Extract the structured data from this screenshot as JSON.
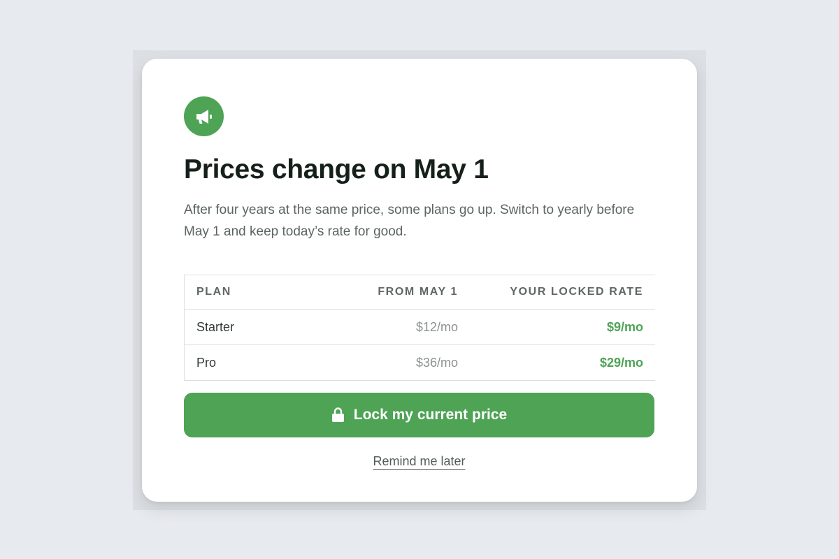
{
  "dialog": {
    "icon": "megaphone-icon",
    "title": "Prices change on May 1",
    "description": "After four years at the same price, some plans go up. Switch to yearly before May 1 and keep today’s rate for good."
  },
  "table": {
    "headers": [
      "PLAN",
      "FROM MAY 1",
      "YOUR LOCKED RATE"
    ],
    "rows": [
      [
        "Starter",
        "$12/mo",
        "$9/mo"
      ],
      [
        "Pro",
        "$36/mo",
        "$29/mo"
      ]
    ]
  },
  "actions": {
    "primary_icon": "lock-icon",
    "primary_label": "Lock my current price",
    "secondary_label": "Remind me later"
  },
  "colors": {
    "accent": "#4ea355",
    "background": "#e7eaee",
    "card": "#ffffff",
    "title": "#16201a"
  }
}
